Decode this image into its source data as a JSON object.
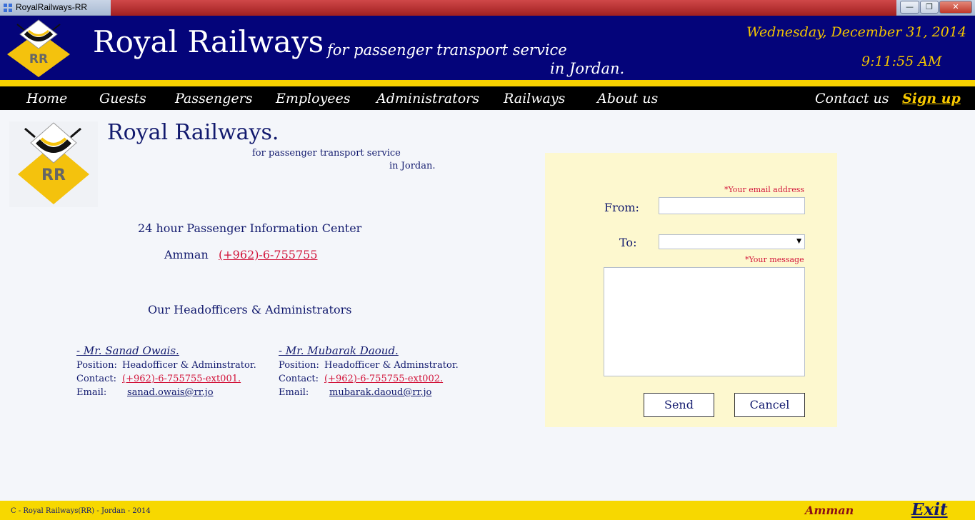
{
  "window": {
    "title": "RoyalRailways-RR",
    "minimize_glyph": "—",
    "maximize_glyph": "❐",
    "close_glyph": "✕"
  },
  "header": {
    "logo_text": "RR",
    "brand": "Royal Railways",
    "tagline_1": "for passenger transport service",
    "tagline_2": "in Jordan.",
    "date": "Wednesday, December 31, 2014",
    "time": "9:11:55 AM"
  },
  "nav": {
    "home": "Home",
    "guests": "Guests",
    "passengers": "Passengers",
    "employees": "Employees",
    "administrators": "Administrators",
    "railways": "Railways",
    "about": "About us",
    "contact": "Contact us",
    "signup": "Sign up"
  },
  "content": {
    "logo_text": "RR",
    "title": "Royal Railways.",
    "tagline_1": "for passenger transport service",
    "tagline_2": "in Jordan.",
    "info_center": "24 hour Passenger Information Center",
    "amman_label": "Amman",
    "amman_phone": "(+962)-6-755755",
    "heads_title": "Our Headofficers & Administrators",
    "officers": [
      {
        "name": "- Mr. Sanad Owais.",
        "position_label": "Position:",
        "position": "Headofficer & Adminstrator.",
        "contact_label": "Contact:",
        "contact": "(+962)-6-755755-ext001.",
        "email_label": "Email:",
        "email": "sanad.owais@rr.jo"
      },
      {
        "name": "- Mr. Mubarak Daoud.",
        "position_label": "Position:",
        "position": "Headofficer & Adminstrator.",
        "contact_label": "Contact:",
        "contact": "(+962)-6-755755-ext002.",
        "email_label": "Email:",
        "email": "mubarak.daoud@rr.jo"
      }
    ]
  },
  "form": {
    "email_hint": "*Your email address",
    "from_label": "From:",
    "from_value": "",
    "to_label": "To:",
    "to_value": "",
    "message_hint": "*Your message",
    "message_value": "",
    "send": "Send",
    "cancel": "Cancel"
  },
  "footer": {
    "copyright": "C - Royal Railways(RR) - Jordan - 2014",
    "city": "Amman",
    "exit": "Exit"
  },
  "colors": {
    "header_blue": "#04047a",
    "accent_yellow": "#f7d100",
    "link_red": "#d2143a",
    "form_bg": "#fdf8cf"
  }
}
